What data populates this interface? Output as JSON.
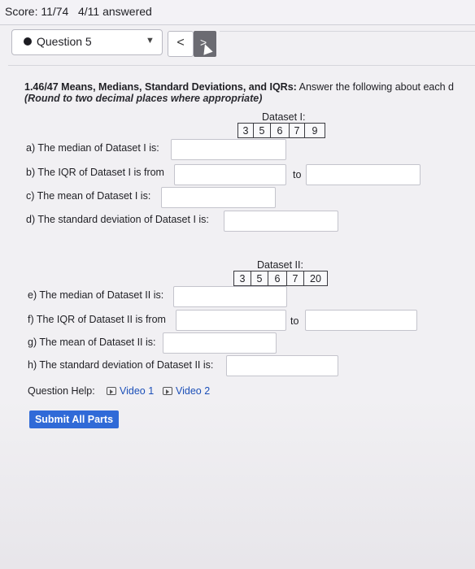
{
  "header": {
    "score": "Score: 11/74",
    "answered": "4/11 answered"
  },
  "question_selector": {
    "label": "Question 5"
  },
  "nav": {
    "prev_glyph": "<",
    "next_glyph": ">"
  },
  "problem": {
    "title_bold": "1.46/47 Means, Medians, Standard Deviations, and IQRs:",
    "title_rest": " Answer the following about each d",
    "subtitle": "(Round to two decimal places where appropriate)"
  },
  "dataset1": {
    "caption": "Dataset I:",
    "values": [
      "3",
      "5",
      "6",
      "7",
      "9"
    ]
  },
  "dataset2": {
    "caption": "Dataset II:",
    "values": [
      "3",
      "5",
      "6",
      "7",
      "20"
    ]
  },
  "questions": {
    "a": "a) The median of Dataset I is:",
    "b": "b) The IQR of Dataset I is from",
    "c": "c) The mean of Dataset I is:",
    "d": "d) The standard deviation of Dataset I is:",
    "e": "e) The median of Dataset II is:",
    "f": "f) The IQR of Dataset II is from",
    "g": "g) The mean of Dataset II is:",
    "h": "h) The standard deviation of Dataset II is:",
    "to": "to"
  },
  "help": {
    "label": "Question Help:",
    "video1": "Video 1",
    "video2": "Video 2"
  },
  "submit_label": "Submit All Parts",
  "colors": {
    "accent": "#2f6ad8",
    "link": "#1b4fb8"
  }
}
